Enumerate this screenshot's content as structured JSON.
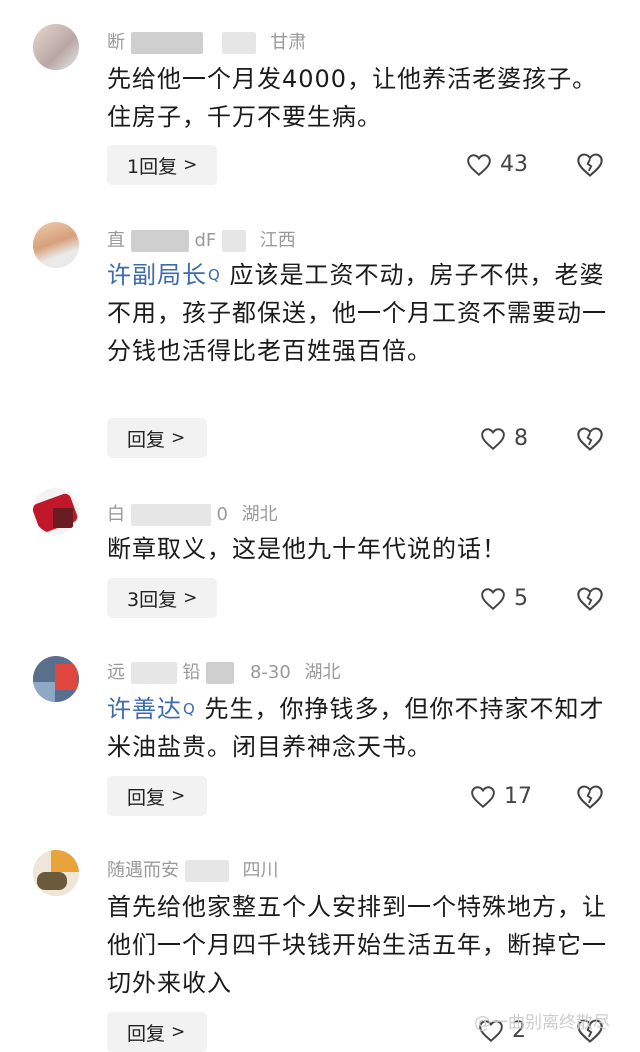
{
  "comments": [
    {
      "username": "断",
      "region": "甘肃",
      "segments": [
        {
          "text": "先给他一个月发4000，让他养活老婆孩子。住房子，千万不要生病。"
        }
      ],
      "reply_label": "1回复",
      "likes": "43"
    },
    {
      "username": "直",
      "username_tail": "dF",
      "region": "江西",
      "mention": "许副局长",
      "segments": [
        {
          "text": "应该是工资不动，房子不供，老婆不用，孩子都保送，他一个月工资不需要动一分钱也活得比老百姓强百倍。"
        }
      ],
      "reply_label": "回复",
      "likes": "8"
    },
    {
      "username": "白",
      "username_tail": "0",
      "region": "湖北",
      "segments": [
        {
          "text": "断章取义，这是他九十年代说的话！"
        }
      ],
      "reply_label": "3回复",
      "likes": "5"
    },
    {
      "username": "远",
      "username_mid": "铅",
      "date": "8-30",
      "region": "湖北",
      "mention": "许善达",
      "segments": [
        {
          "text": "先生，你挣钱多，但你不持家不知才米油盐贵。闭目养神念天书。"
        }
      ],
      "reply_label": "回复",
      "likes": "17"
    },
    {
      "username": "随遇而安",
      "region": "四川",
      "segments": [
        {
          "text": "首先给他家整五个人安排到一个特殊地方，让他们一个月四千块钱开始生活五年，断掉它一切外来收入"
        }
      ],
      "reply_label": "回复",
      "likes": "2"
    }
  ],
  "icons": {
    "like": "heart-outline-icon",
    "dislike": "broken-heart-icon",
    "reply_chevron": "chevron-right-icon",
    "mention_mark": "search-magnifier-icon"
  },
  "colors": {
    "mention": "#3d6bb0",
    "meta": "#9a9a9a",
    "reply_bg": "#f2f2f2"
  },
  "watermark": "@一曲别离终散尽",
  "mention_glyph": "Q",
  "chevron_glyph": ">"
}
